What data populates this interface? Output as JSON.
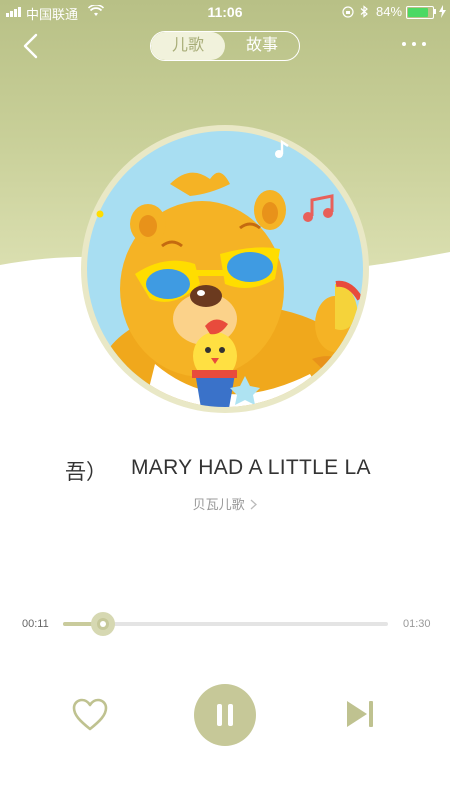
{
  "status_bar": {
    "carrier": "中国联通",
    "time": "11:06",
    "battery_percent": "84%",
    "battery_level": 0.84
  },
  "header": {
    "tabs": [
      {
        "label": "儿歌",
        "active": true
      },
      {
        "label": "故事",
        "active": false
      }
    ]
  },
  "track": {
    "title_fragment": "吾）",
    "title": "MARY HAD A LITTLE LA",
    "artist": "贝瓦儿歌"
  },
  "player": {
    "current_time": "00:11",
    "total_time": "01:30",
    "progress": 0.122,
    "state": "playing"
  },
  "icons": {
    "back": "chevron-left-icon",
    "more": "more-dots-icon",
    "like": "heart-icon",
    "pause": "pause-icon",
    "next": "skip-next-icon"
  },
  "colors": {
    "accent": "#c6c898",
    "header_bg": "#bfc68f"
  }
}
